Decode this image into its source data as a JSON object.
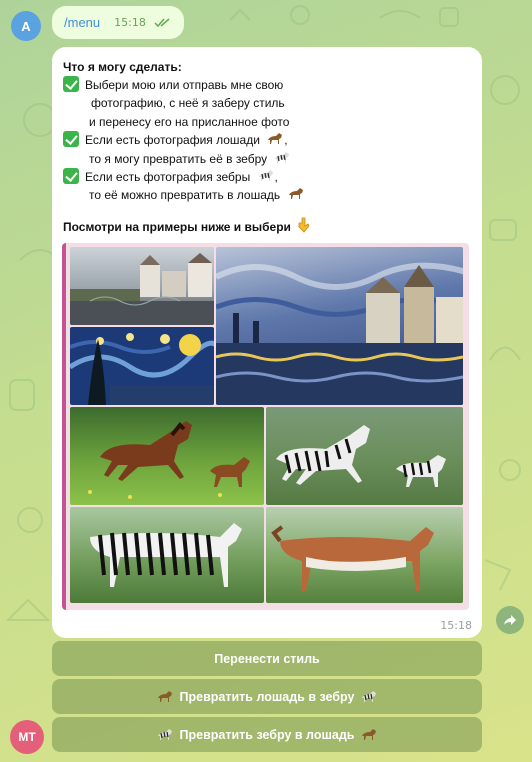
{
  "user": {
    "avatar_letter": "A"
  },
  "bot": {
    "avatar_initials": "MT"
  },
  "outgoing": {
    "command": "/menu",
    "time": "15:18"
  },
  "bot_message": {
    "heading": "Что я могу сделать:",
    "lines": [
      "Выбери мою или отправь мне свою",
      "фотографию, с неё я заберу стиль",
      "и перенесу его на присланное фото",
      "Если есть фотография лошади",
      "то я могу превратить её в зебру",
      "Если есть фотография зебры",
      "то её можно превратить в лошадь"
    ],
    "examples_label": "Посмотри на примеры ниже и выбери",
    "time": "15:18"
  },
  "keyboard": [
    {
      "label": "Перенести стиль"
    },
    {
      "label": "Превратить лошадь в зебру"
    },
    {
      "label": "Превратить зебру в лошадь"
    }
  ],
  "icons": {
    "check": "check-mark-icon",
    "horse": "horse-emoji-icon",
    "zebra": "zebra-emoji-icon",
    "point_down": "pointing-down-icon",
    "read_ticks": "double-check-icon",
    "share": "share-arrow-icon"
  },
  "colors": {
    "link": "#3f8fd6",
    "check_green": "#3bb54a",
    "collage_accent": "#c25493"
  }
}
